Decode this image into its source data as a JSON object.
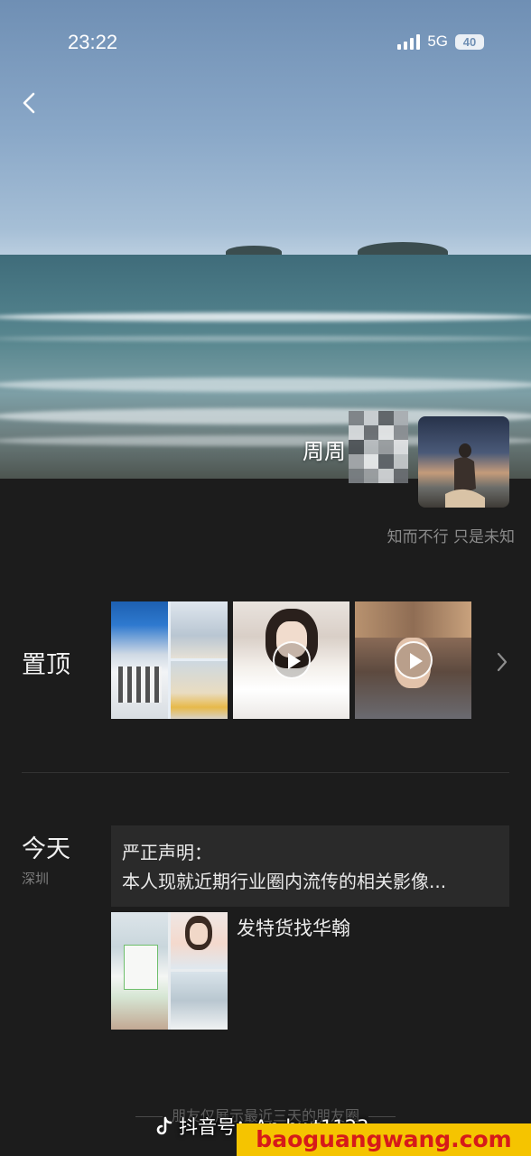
{
  "status_bar": {
    "time": "23:22",
    "network": "5G",
    "battery": "40"
  },
  "profile": {
    "nickname": "周周",
    "signature": "知而不行 只是未知"
  },
  "pinned": {
    "label": "置顶"
  },
  "today": {
    "label": "今天",
    "location": "深圳",
    "text_post": {
      "line1": "严正声明：",
      "line2": "本人现就近期行业圈内流传的相关影像..."
    },
    "photo_post_caption": "发特货找华翰"
  },
  "footer": {
    "note": "朋友仅展示最近三天的朋友圈"
  },
  "watermark": {
    "douyin_label": "抖音号：An.hwt1123",
    "site": "baoguangwang.com"
  },
  "icons": {
    "back": "chevron-left-icon",
    "more": "chevron-right-icon",
    "play": "play-icon",
    "douyin": "douyin-logo-icon"
  }
}
